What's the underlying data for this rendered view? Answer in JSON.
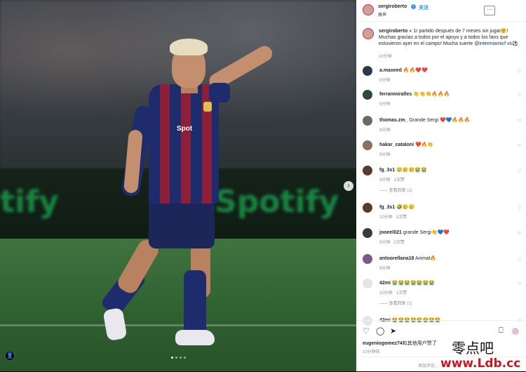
{
  "post": {
    "username": "sergiroberto",
    "verified_badge": "✓",
    "follow_label": "关注",
    "sub_label": "原声",
    "more_icon": "more-icon",
    "caption": {
      "username": "sergiroberto",
      "text": "1r partido después de 7 meses sin jugar🤗! Muchas gracias a todos por el apoyo y a todos los fans que estuvieron ayer en el campo! Mucha suerte ",
      "mention": "@intermiamicf",
      "tail": " vs⚽",
      "time": "10分钟"
    }
  },
  "photo": {
    "board_text_left": "tify",
    "board_text_right": "Spotify",
    "sponsor": "Spot",
    "next_arrow": "›",
    "tag_icon": "👤"
  },
  "comments": [
    {
      "user": "a.maxeed",
      "text": "🔥🔥❤️❤️",
      "meta": "9分钟",
      "color": "#2b3a4a"
    },
    {
      "user": "ferranmiralles",
      "text": "👏👏👏🔥🔥🔥",
      "meta": "9分钟",
      "color": "#2d4a3a"
    },
    {
      "user": "thomas.zm_",
      "text": "Grande Sergi ❤️💙🔥🔥🔥",
      "meta": "9分钟",
      "color": "#6a6a6a"
    },
    {
      "user": "hakar_cataloni",
      "text": "❤️🔥👏",
      "meta": "9分钟",
      "color": "#8a7060"
    },
    {
      "user": "fg_3s1",
      "text": "🥲🥲🥲😭😭",
      "meta": "9分钟",
      "likes": "1次赞",
      "replies": "查看回复 (1)",
      "color": "#5a3a2a"
    },
    {
      "user": "fg_3s1",
      "text": "🤣🥲🥲",
      "meta": "10分钟",
      "likes": "1次赞",
      "color": "#5a3a2a"
    },
    {
      "user": "jooeel021",
      "text": "grande Sergi👏💙❤️",
      "meta": "9分钟",
      "likes": "2次赞",
      "color": "#3a3a3a"
    },
    {
      "user": "antoorellana18",
      "text": "Animal🔥",
      "meta": "9分钟",
      "color": "#7a5a8a"
    },
    {
      "user": "42mi",
      "text": "😭😭😭😭😭😭😭",
      "meta": "10分钟",
      "likes": "1次赞",
      "replies": "查看回复 (1)",
      "color": "#e5e5e5"
    },
    {
      "user": "42mi",
      "text": "😭😭😭😭😭😭😭😭",
      "meta": "",
      "color": "#e5e5e5"
    }
  ],
  "footer": {
    "likes_user": "eugeniogomez74",
    "likes_suffix": "和其他用户赞了",
    "time": "10分钟前",
    "add_comment_placeholder": "添加评论...",
    "post_button": "发布"
  },
  "watermark": {
    "line1": "零点吧",
    "line2": "www.Ldb.cc"
  }
}
